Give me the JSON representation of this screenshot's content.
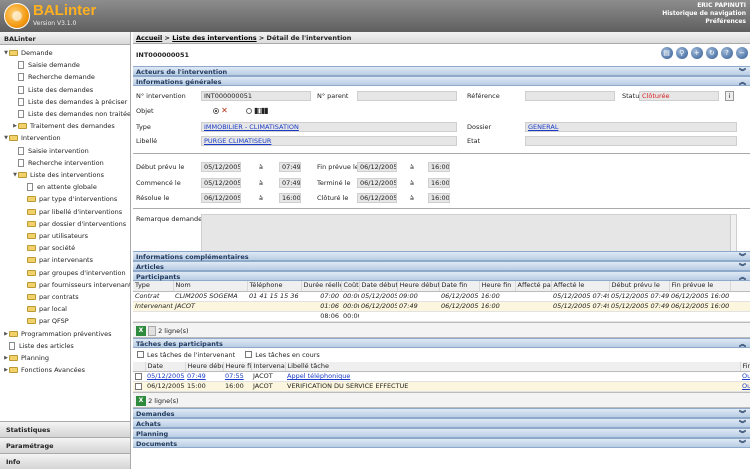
{
  "app": {
    "title": "BALinter",
    "version": "Version V3.1.0"
  },
  "user": {
    "name": "ERIC PAPINUTI",
    "history": "Historique de navigation",
    "prefs": "Préférences"
  },
  "sidebar": {
    "title": "BALinter",
    "tree": [
      {
        "label": "Demande"
      },
      {
        "label": "Saisie demande"
      },
      {
        "label": "Recherche demande"
      },
      {
        "label": "Liste des demandes"
      },
      {
        "label": "Liste des demandes à préciser"
      },
      {
        "label": "Liste des demandes non traitées"
      },
      {
        "label": "Traitement des demandes"
      },
      {
        "label": "Intervention"
      },
      {
        "label": "Saisie intervention"
      },
      {
        "label": "Recherche intervention"
      },
      {
        "label": "Liste des interventions"
      },
      {
        "label": "en attente globale"
      },
      {
        "label": "par type d'interventions"
      },
      {
        "label": "par libellé d'interventions"
      },
      {
        "label": "par dossier d'interventions"
      },
      {
        "label": "par utilisateurs"
      },
      {
        "label": "par société"
      },
      {
        "label": "par intervenants"
      },
      {
        "label": "par groupes d'intervention"
      },
      {
        "label": "par fournisseurs intervenants"
      },
      {
        "label": "par contrats"
      },
      {
        "label": "par local"
      },
      {
        "label": "par QFSP"
      },
      {
        "label": "Programmation préventives"
      },
      {
        "label": "Liste des articles"
      },
      {
        "label": "Planning"
      },
      {
        "label": "Fonctions Avancées"
      }
    ],
    "bottom": [
      "Statistiques",
      "Paramétrage",
      "Info"
    ]
  },
  "breadcrumb": {
    "home": "Accueil",
    "list": "Liste des interventions",
    "current": "> Détail de l'intervention"
  },
  "record_id": "INT000000051",
  "sections": {
    "acteurs": "Acteurs de l'intervention",
    "infos": "Informations générales",
    "complementaires": "Informations complémentaires",
    "articles": "Articles",
    "participants": "Participants",
    "taches": "Tâches des participants",
    "demandes": "Demandes",
    "achats": "Achats",
    "planning": "Planning",
    "documents": "Documents"
  },
  "general": {
    "num_label": "N° intervention",
    "num_value": "INT000000051",
    "parent_label": "N° parent",
    "parent_value": "",
    "ref_label": "Référence",
    "ref_value": "",
    "statut_label": "Statut",
    "statut_value": "Clôturée",
    "objet_label": "Objet",
    "type_label": "Type",
    "type_value": "IMMOBILIER - CLIMATISATION",
    "dossier_label": "Dossier",
    "dossier_value": "GENERAL",
    "libelle_label": "Libellé",
    "libelle_value": "PURGE CLIMATISEUR",
    "etat_label": "Etat",
    "etat_value": ""
  },
  "dates": {
    "a_label": "à",
    "rows": [
      {
        "l1": "Début prévu le",
        "d1": "05/12/2005",
        "t1": "07:49",
        "l2": "Fin prévue le",
        "d2": "06/12/2005",
        "t2": "16:00"
      },
      {
        "l1": "Commencé le",
        "d1": "05/12/2005",
        "t1": "07:49",
        "l2": "Terminé le",
        "d2": "06/12/2005",
        "t2": "16:00"
      },
      {
        "l1": "Résolue le",
        "d1": "06/12/2005",
        "t1": "16:00",
        "l2": "Clôturé le",
        "d2": "06/12/2005",
        "t2": "16:00"
      }
    ]
  },
  "remark_label": "Remarque demandeur",
  "participants": {
    "headers": [
      "Type",
      "Nom",
      "Téléphone",
      "Durée réelle",
      "Coût",
      "Date début",
      "Heure début",
      "Date fin",
      "Heure fin",
      "Affecté par",
      "Affecté le",
      "Début prévu le",
      "Fin prévue le"
    ],
    "rows": [
      [
        "Contrat",
        "CLIM2005 SOGEMA",
        "01 41 15 15 36",
        "07:00",
        "00:00",
        "05/12/2005",
        "09:00",
        "06/12/2005",
        "16:00",
        "",
        "05/12/2005 07:49",
        "05/12/2005 07:49",
        "06/12/2005 16:00"
      ],
      [
        "Intervenant",
        "JACOT",
        "",
        "01:06",
        "00:00",
        "06/12/2005",
        "07:49",
        "06/12/2005",
        "16:00",
        "",
        "05/12/2005 07:49",
        "05/12/2005 07:49",
        "06/12/2005 16:00"
      ]
    ],
    "total": [
      "08:06",
      "00:00"
    ],
    "count": "2 ligne(s)"
  },
  "tasks": {
    "cb1": "Les tâches de l'intervenant",
    "cb2": "Les tâches en cours",
    "headers": [
      "",
      "Date",
      "Heure début",
      "Heure fin",
      "Intervenant",
      "Libellé tâche",
      "Fin"
    ],
    "rows": [
      [
        "",
        "05/12/2005",
        "07:49",
        "07:55",
        "JACOT",
        "Appel téléphonique",
        "Oui"
      ],
      [
        "",
        "06/12/2005",
        "15:00",
        "16:00",
        "JACOT",
        "VERIFICATION DU SERVICE EFFECTUE",
        "Oui"
      ]
    ],
    "count": "2 ligne(s)"
  },
  "colors": {
    "accent": "#f39a12",
    "section": "#b9cde4",
    "link": "#1a3cc8",
    "status": "#d62020"
  }
}
